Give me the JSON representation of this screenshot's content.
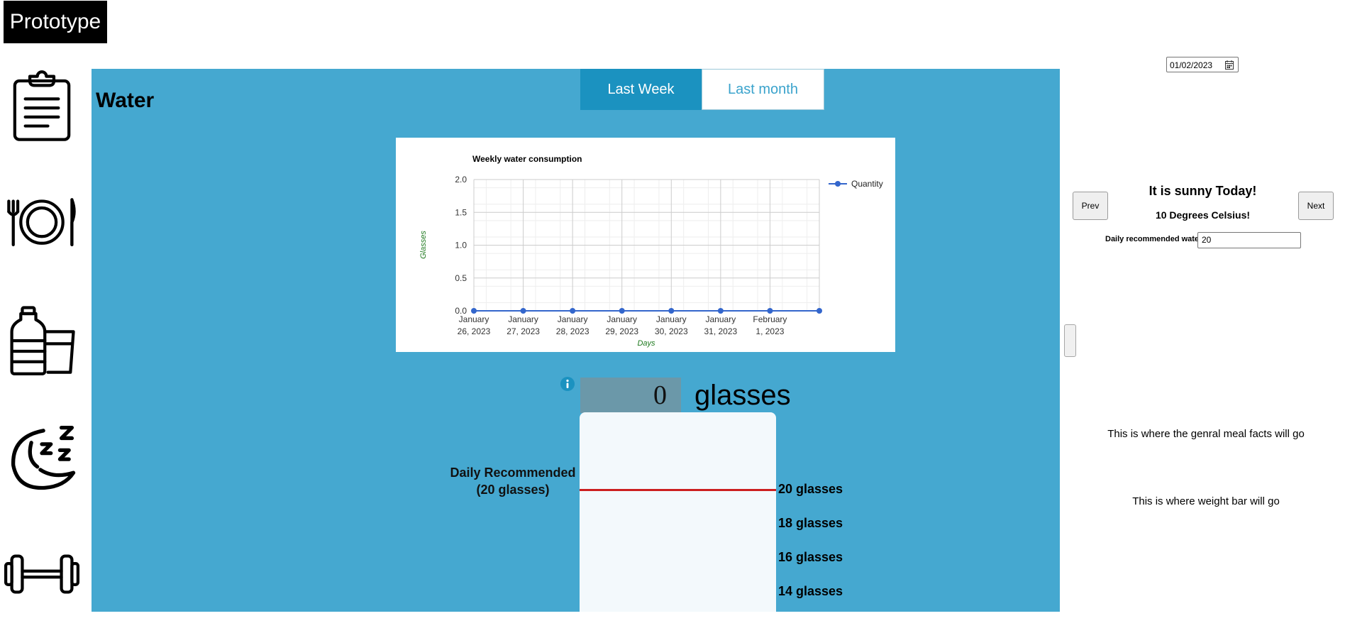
{
  "brand": {
    "label": "Prototype"
  },
  "nav": {
    "items": [
      {
        "name": "log",
        "icon": "clipboard-icon"
      },
      {
        "name": "meals",
        "icon": "plate-cutlery-icon"
      },
      {
        "name": "water",
        "icon": "bottle-glass-icon"
      },
      {
        "name": "sleep",
        "icon": "moon-zzz-icon"
      },
      {
        "name": "exercise",
        "icon": "dumbbell-icon"
      }
    ]
  },
  "main": {
    "title": "Water",
    "tabs": [
      {
        "label": "Last Week",
        "active": true
      },
      {
        "label": "Last month",
        "active": false
      }
    ],
    "panel_color": "#45a8d0"
  },
  "chart_data": {
    "type": "line",
    "title": "Weekly water consumption",
    "xlabel": "Days",
    "ylabel": "Glasses",
    "ylim": [
      0,
      2
    ],
    "yticks": [
      "0.0",
      "0.5",
      "1.0",
      "1.5",
      "2.0"
    ],
    "categories": [
      [
        "January",
        "26, 2023"
      ],
      [
        "January",
        "27, 2023"
      ],
      [
        "January",
        "28, 2023"
      ],
      [
        "January",
        "29, 2023"
      ],
      [
        "January",
        "30, 2023"
      ],
      [
        "January",
        "31, 2023"
      ],
      [
        "February",
        "1, 2023"
      ],
      [
        "",
        ""
      ]
    ],
    "series": [
      {
        "name": "Quantity",
        "values": [
          0,
          0,
          0,
          0,
          0,
          0,
          0,
          0
        ],
        "color": "#3366cc"
      }
    ],
    "legend": "top-right",
    "grid": true
  },
  "counter": {
    "value": "0",
    "unit": "glasses",
    "info_icon": "info-icon"
  },
  "glass": {
    "daily_recommended": "Daily Recommended",
    "daily_recommended_amount": "(20 glasses)",
    "target_color": "#cc1f1f",
    "levels": [
      "20 glasses",
      "18 glasses",
      "16 glasses",
      "14 glasses"
    ]
  },
  "sidebar": {
    "date": "01/02/2023",
    "prev_label": "Prev",
    "next_label": "Next",
    "weather_title": "It is sunny Today!",
    "weather_temp": "10 Degrees Celsius!",
    "water_label": "Daily recommended water",
    "water_value": "20",
    "meal_facts": "This is where the genral meal facts will go",
    "weight_bar": "This is where weight bar will go"
  }
}
